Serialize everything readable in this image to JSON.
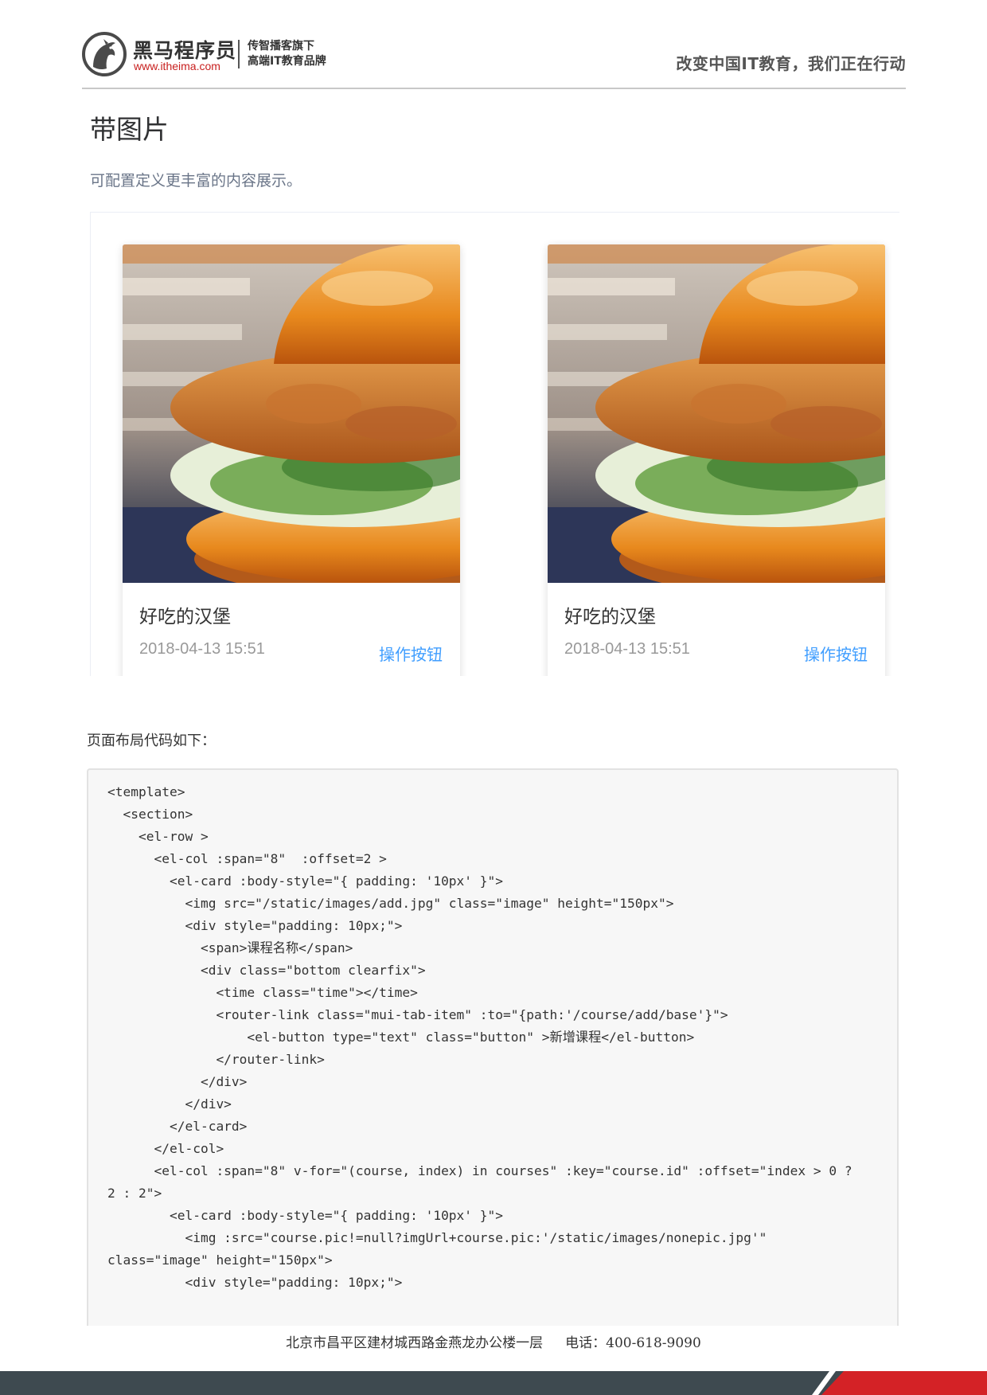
{
  "header": {
    "logo_name": "黑马程序员",
    "logo_url": "www.itheima.com",
    "logo_tag_line1": "传智播客旗下",
    "logo_tag_line2": "高端IT教育品牌",
    "slogan": "改变中国IT教育，我们正在行动"
  },
  "section": {
    "title": "带图片",
    "description": "可配置定义更丰富的内容展示。"
  },
  "cards": [
    {
      "title": "好吃的汉堡",
      "time": "2018-04-13 15:51",
      "button": "操作按钮",
      "image": "hamburger-photo"
    },
    {
      "title": "好吃的汉堡",
      "time": "2018-04-13 15:51",
      "button": "操作按钮",
      "image": "hamburger-photo"
    }
  ],
  "code": {
    "intro": "页面布局代码如下：",
    "lines": [
      "<template>",
      "  <section>",
      "    <el-row >",
      "      <el-col :span=\"8\"  :offset=2 >",
      "        <el-card :body-style=\"{ padding: '10px' }\">",
      "          <img src=\"/static/images/add.jpg\" class=\"image\" height=\"150px\">",
      "          <div style=\"padding: 10px;\">",
      "            <span>课程名称</span>",
      "            <div class=\"bottom clearfix\">",
      "              <time class=\"time\"></time>",
      "              <router-link class=\"mui-tab-item\" :to=\"{path:'/course/add/base'}\">",
      "                  <el-button type=\"text\" class=\"button\" >新增课程</el-button>",
      "              </router-link>",
      "            </div>",
      "          </div>",
      "        </el-card>",
      "      </el-col>",
      "      <el-col :span=\"8\" v-for=\"(course, index) in courses\" :key=\"course.id\" :offset=\"index > 0 ?",
      "2 : 2\">",
      "        <el-card :body-style=\"{ padding: '10px' }\">",
      "          <img :src=\"course.pic!=null?imgUrl+course.pic:'/static/images/nonepic.jpg'\"",
      "class=\"image\" height=\"150px\">",
      "          <div style=\"padding: 10px;\">"
    ]
  },
  "footer": {
    "address": "北京市昌平区建材城西路金燕龙办公楼一层",
    "phone": "电话：400-618-9090"
  },
  "colors": {
    "accent_link": "#409eff",
    "brand_red": "#d42226",
    "bar_dark": "#3e4a50"
  }
}
